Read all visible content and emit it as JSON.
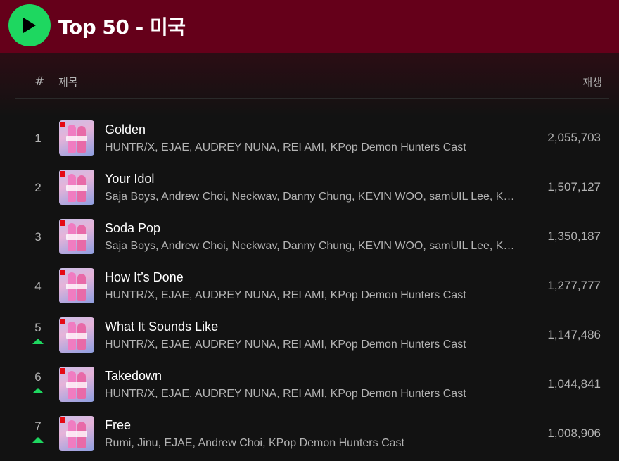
{
  "header": {
    "title": "Top 50 - 미국",
    "background": "#65001a",
    "play_color": "#1ed760"
  },
  "columns": {
    "rank": "#",
    "title": "제목",
    "plays": "재생"
  },
  "tracks": [
    {
      "rank": "1",
      "title": "Golden",
      "artists": "HUNTR/X, EJAE, AUDREY NUNA, REI AMI, KPop Demon Hunters Cast",
      "plays": "2,055,703",
      "trend": "none"
    },
    {
      "rank": "2",
      "title": "Your Idol",
      "artists": "Saja Boys, Andrew Choi, Neckwav, Danny Chung, KEVIN WOO, samUIL Lee, KPop Demon Hunters Cast",
      "plays": "1,507,127",
      "trend": "none"
    },
    {
      "rank": "3",
      "title": "Soda Pop",
      "artists": "Saja Boys, Andrew Choi, Neckwav, Danny Chung, KEVIN WOO, samUIL Lee, KPop Demon Hunters Cast",
      "plays": "1,350,187",
      "trend": "none"
    },
    {
      "rank": "4",
      "title": "How It’s Done",
      "artists": "HUNTR/X, EJAE, AUDREY NUNA, REI AMI, KPop Demon Hunters Cast",
      "plays": "1,277,777",
      "trend": "none"
    },
    {
      "rank": "5",
      "title": "What It Sounds Like",
      "artists": "HUNTR/X, EJAE, AUDREY NUNA, REI AMI, KPop Demon Hunters Cast",
      "plays": "1,147,486",
      "trend": "up"
    },
    {
      "rank": "6",
      "title": "Takedown",
      "artists": "HUNTR/X, EJAE, AUDREY NUNA, REI AMI, KPop Demon Hunters Cast",
      "plays": "1,044,841",
      "trend": "up"
    },
    {
      "rank": "7",
      "title": "Free",
      "artists": "Rumi, Jinu, EJAE, Andrew Choi, KPop Demon Hunters Cast",
      "plays": "1,008,906",
      "trend": "up"
    }
  ]
}
